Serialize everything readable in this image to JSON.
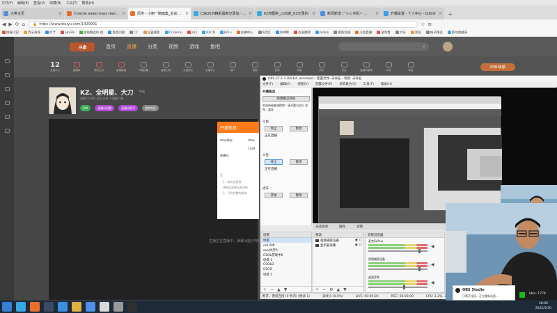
{
  "menubar": [
    "文件(F)",
    "编辑(E)",
    "查看(V)",
    "收藏(B)",
    "工具(T)",
    "帮助(H)"
  ],
  "tabs": [
    {
      "label": "大笑主页",
      "color": "#5b8bd5",
      "active": false
    },
    {
      "label": "Список известных нам карт",
      "color": "#e86f2a",
      "active": false
    },
    {
      "label": "风传 - 小丽一碗面集_总动精彩",
      "color": "#e86f2a",
      "active": true
    },
    {
      "label": "CSKZCN精彩最新记录站 - Kre",
      "color": "#3aa7e0",
      "active": false
    },
    {
      "label": "KZ地图补_cs玩家_KZ记录的",
      "color": "#3aa7e0",
      "active": false
    },
    {
      "label": "新闻新增 ( \"ɔ-ɔ 手机~ ...",
      "color": "#4f8fe6",
      "active": false
    },
    {
      "label": "开播设置 - 个人中心 - bilibili",
      "color": "#3b9ee8",
      "active": false
    }
  ],
  "address": {
    "url": "https://www.douyu.com/1429901"
  },
  "bookmarks": [
    {
      "label": "桃秘小说",
      "color": "#e0504a"
    },
    {
      "label": "苏宁商城",
      "color": "#f0a030"
    },
    {
      "label": "打卡",
      "color": "#3a8ee0"
    },
    {
      "label": "aini99",
      "color": "#e05050"
    },
    {
      "label": "总站精选DL组",
      "color": "#4cae4c"
    },
    {
      "label": "百度问题",
      "color": "#3a8ee0"
    },
    {
      "label": "CC",
      "color": "#888888"
    },
    {
      "label": "设置最新",
      "color": "#e0a030"
    },
    {
      "label": "CCdemo",
      "color": "#3aa7e0"
    },
    {
      "label": "162",
      "color": "#e05050"
    },
    {
      "label": "KZCN",
      "color": "#3aa7e0"
    },
    {
      "label": "KZru",
      "color": "#3aa7e0"
    },
    {
      "label": "主播中心",
      "color": "#e86f2a"
    },
    {
      "label": "X社区",
      "color": "#888888"
    },
    {
      "label": "剑神降",
      "color": "#3a8ee0"
    },
    {
      "label": "有道翻译",
      "color": "#e05050"
    },
    {
      "label": "bilibili",
      "color": "#3b9ee8"
    },
    {
      "label": "搜狗加速",
      "color": "#888888"
    },
    {
      "label": "斗鱼直播",
      "color": "#e86f2a"
    },
    {
      "label": "游戏鲁",
      "color": "#e05050"
    },
    {
      "label": "大号",
      "color": "#888888"
    },
    {
      "label": "完美",
      "color": "#e0a030"
    },
    {
      "label": "帖子精选",
      "color": "#888888"
    },
    {
      "label": "移动收藏夹",
      "color": "#3aa7e0"
    }
  ],
  "douyu": {
    "logo": "斗鱼",
    "nav": [
      "首页",
      "直播",
      "分类",
      "视频",
      "游戏",
      "鱼吧"
    ],
    "nav_active_index": 1,
    "stats_num": "12",
    "stats_label": "主播中心",
    "top_icons": [
      "直播间",
      "我的主页",
      "直播数据",
      "开播设置",
      "直播工具",
      "主播任务",
      "主播中心",
      "用户",
      "视频",
      "鱼吧",
      "消息",
      "历史",
      "关注",
      "直播间管理",
      "派对",
      "收益"
    ],
    "pobi": "POBI余额"
  },
  "profile": {
    "name": "KZ、全明星、大刀",
    "report": "举报",
    "sub": "直播  CS:GO  关注  分享  下载客户端",
    "badges": [
      {
        "label": "LV8",
        "color": "#3cae5c"
      },
      {
        "label": "直播间设置",
        "color": "#b04ad8"
      },
      {
        "label": "直播间助手",
        "color": "#b04ad8"
      },
      {
        "label": "游戏专区",
        "color": "#888888"
      }
    ]
  },
  "danmu": "主播正在直播中，弹幕功能已开启",
  "dialog": {
    "title": "开播信息",
    "rtmp_label": "rtmp地址：",
    "rtmp_value": "rtmp",
    "code_label": "直播码：",
    "code_value": "1429",
    "hint": "注：",
    "lines": [
      "1、每次连接前",
      "请到这里确认推流码",
      "2、只有完整的推流"
    ]
  },
  "obs": {
    "title": "OBS 27.1.3 (64-bit, windows) - 配置文件: 未命名 - 场景: 未命名",
    "menu": [
      "文件(F)",
      "编辑(E)",
      "视图(V)",
      "配置文件(P)",
      "场景集合(S)",
      "工具(T)",
      "帮助(H)"
    ],
    "left_title": "开播推流",
    "left_button": "新建推流目标",
    "left_hint": "本站所有推流提供：请不要与主打 发布：盖哇",
    "groups": [
      {
        "title": "斗鱼",
        "start": "停止",
        "stop": "暂停",
        "status": "正在直播"
      },
      {
        "title": "斗鱼",
        "start": "停止",
        "stop": "暂停",
        "status": "正在直播"
      },
      {
        "title": "虎牙",
        "start": "开始",
        "stop": "暂停",
        "status": ""
      }
    ],
    "scene_strip": [
      "未选择源",
      "属性",
      "滤镜"
    ],
    "scenes": {
      "title": "场景",
      "items": [
        "场景",
        "cs1.6中",
        "csol大厅6",
        "CSOL游戏中6",
        "场景 2",
        "CSOLD",
        "CSGO",
        "场景 3"
      ],
      "selected": 0
    },
    "sources": {
      "title": "来源",
      "items": [
        "视频捕获设备",
        "显示器采集"
      ]
    },
    "mixer": {
      "title": "音频混音器",
      "channels": [
        {
          "name": "麦克风/Aux",
          "level": 0.85
        },
        {
          "name": "视频捕获设备",
          "level": 0.85
        },
        {
          "name": "桌面音频",
          "level": 0.6
        }
      ]
    },
    "status": [
      "断开，重新连接 (0 秒内) (尝试 1)",
      "丢帧 0 (0.0%)",
      "LIVE: 00:00:00",
      "REC: 00:00:00",
      "CPU: 1.2%, 30.00 fps"
    ]
  },
  "toast": {
    "title": "OBS Studio",
    "body": "已断开连接，正在重新连接..."
  },
  "kbps": "kb/s: 1779",
  "taskbar": {
    "apps": [
      {
        "name": "start",
        "color": "#3a7fd5"
      },
      {
        "name": "ie",
        "color": "#3aa7e0"
      },
      {
        "name": "firefox",
        "color": "#e86f2a"
      },
      {
        "name": "steam",
        "color": "#3a4a60"
      },
      {
        "name": "media",
        "color": "#3a8ee0"
      },
      {
        "name": "folder",
        "color": "#e0b040"
      },
      {
        "name": "browser",
        "color": "#4f8fe6"
      },
      {
        "name": "cs",
        "color": "#d9d9d9"
      },
      {
        "name": "cs-alt",
        "color": "#9a9a9a"
      },
      {
        "name": "obs",
        "color": "#303030"
      }
    ],
    "time": "20:06",
    "date": "2022/3/30"
  }
}
